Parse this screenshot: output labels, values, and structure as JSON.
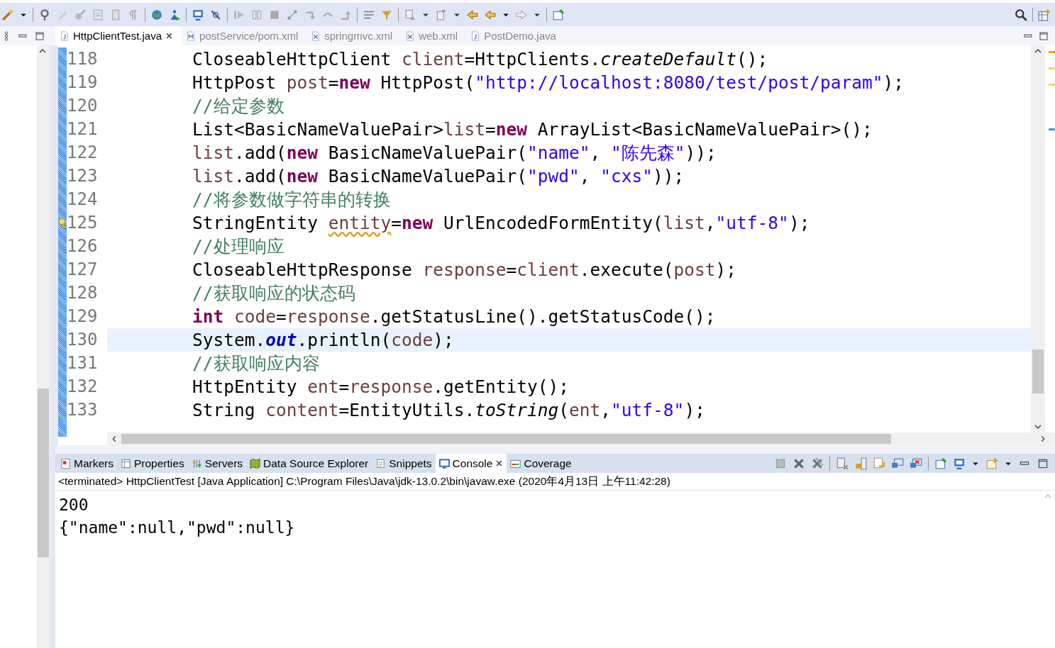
{
  "editor_tabs": [
    {
      "label": "HttpClientTest.java",
      "selected": true,
      "kind": "java"
    },
    {
      "label": "postService/pom.xml",
      "selected": false,
      "kind": "maven"
    },
    {
      "label": "springmvc.xml",
      "selected": false,
      "kind": "xml"
    },
    {
      "label": "web.xml",
      "selected": false,
      "kind": "xml"
    },
    {
      "label": "PostDemo.java",
      "selected": false,
      "kind": "java"
    }
  ],
  "code_lines": [
    {
      "number": "118",
      "current": false,
      "warning": false,
      "tokens": [
        {
          "kind": "plain",
          "text": "CloseableHttpClient "
        },
        {
          "kind": "variable",
          "text": "client"
        },
        {
          "kind": "plain",
          "text": "=HttpClients."
        },
        {
          "kind": "static_method",
          "text": "createDefault"
        },
        {
          "kind": "plain",
          "text": "();"
        }
      ]
    },
    {
      "number": "119",
      "current": false,
      "warning": false,
      "tokens": [
        {
          "kind": "plain",
          "text": "HttpPost "
        },
        {
          "kind": "variable",
          "text": "post"
        },
        {
          "kind": "plain",
          "text": "="
        },
        {
          "kind": "keyword",
          "text": "new"
        },
        {
          "kind": "plain",
          "text": " HttpPost("
        },
        {
          "kind": "string",
          "text": "\"http://localhost:8080/test/post/param\""
        },
        {
          "kind": "plain",
          "text": ");"
        }
      ]
    },
    {
      "number": "120",
      "current": false,
      "warning": false,
      "tokens": [
        {
          "kind": "comment",
          "text": "//给定参数"
        }
      ]
    },
    {
      "number": "121",
      "current": false,
      "warning": false,
      "tokens": [
        {
          "kind": "plain",
          "text": "List<BasicNameValuePair>"
        },
        {
          "kind": "variable",
          "text": "list"
        },
        {
          "kind": "plain",
          "text": "="
        },
        {
          "kind": "keyword",
          "text": "new"
        },
        {
          "kind": "plain",
          "text": " ArrayList<BasicNameValuePair>();"
        }
      ]
    },
    {
      "number": "122",
      "current": false,
      "warning": false,
      "tokens": [
        {
          "kind": "variable",
          "text": "list"
        },
        {
          "kind": "plain",
          "text": ".add("
        },
        {
          "kind": "keyword",
          "text": "new"
        },
        {
          "kind": "plain",
          "text": " BasicNameValuePair("
        },
        {
          "kind": "string",
          "text": "\"name\""
        },
        {
          "kind": "plain",
          "text": ", "
        },
        {
          "kind": "string",
          "text": "\"陈先森\""
        },
        {
          "kind": "plain",
          "text": "));"
        }
      ]
    },
    {
      "number": "123",
      "current": false,
      "warning": false,
      "tokens": [
        {
          "kind": "variable",
          "text": "list"
        },
        {
          "kind": "plain",
          "text": ".add("
        },
        {
          "kind": "keyword",
          "text": "new"
        },
        {
          "kind": "plain",
          "text": " BasicNameValuePair("
        },
        {
          "kind": "string",
          "text": "\"pwd\""
        },
        {
          "kind": "plain",
          "text": ", "
        },
        {
          "kind": "string",
          "text": "\"cxs\""
        },
        {
          "kind": "plain",
          "text": "));"
        }
      ]
    },
    {
      "number": "124",
      "current": false,
      "warning": false,
      "tokens": [
        {
          "kind": "comment",
          "text": "//将参数做字符串的转换"
        }
      ]
    },
    {
      "number": "125",
      "current": false,
      "warning": true,
      "tokens": [
        {
          "kind": "plain",
          "text": "StringEntity "
        },
        {
          "kind": "warned_variable",
          "text": "entity"
        },
        {
          "kind": "plain",
          "text": "="
        },
        {
          "kind": "keyword",
          "text": "new"
        },
        {
          "kind": "plain",
          "text": " UrlEncodedFormEntity("
        },
        {
          "kind": "variable",
          "text": "list"
        },
        {
          "kind": "plain",
          "text": ","
        },
        {
          "kind": "string",
          "text": "\"utf-8\""
        },
        {
          "kind": "plain",
          "text": ");"
        }
      ]
    },
    {
      "number": "126",
      "current": false,
      "warning": false,
      "tokens": [
        {
          "kind": "comment",
          "text": "//处理响应"
        }
      ]
    },
    {
      "number": "127",
      "current": false,
      "warning": false,
      "tokens": [
        {
          "kind": "plain",
          "text": "CloseableHttpResponse "
        },
        {
          "kind": "variable",
          "text": "response"
        },
        {
          "kind": "plain",
          "text": "="
        },
        {
          "kind": "variable",
          "text": "client"
        },
        {
          "kind": "plain",
          "text": ".execute("
        },
        {
          "kind": "variable",
          "text": "post"
        },
        {
          "kind": "plain",
          "text": ");"
        }
      ]
    },
    {
      "number": "128",
      "current": false,
      "warning": false,
      "tokens": [
        {
          "kind": "comment",
          "text": "//获取响应的状态码"
        }
      ]
    },
    {
      "number": "129",
      "current": false,
      "warning": false,
      "tokens": [
        {
          "kind": "keyword",
          "text": "int"
        },
        {
          "kind": "variable",
          "text": " code"
        },
        {
          "kind": "plain",
          "text": "="
        },
        {
          "kind": "variable",
          "text": "response"
        },
        {
          "kind": "plain",
          "text": ".getStatusLine().getStatusCode();"
        }
      ]
    },
    {
      "number": "130",
      "current": true,
      "warning": false,
      "tokens": [
        {
          "kind": "plain",
          "text": "System."
        },
        {
          "kind": "static_field",
          "text": "out"
        },
        {
          "kind": "plain",
          "text": ".println("
        },
        {
          "kind": "variable",
          "text": "code"
        },
        {
          "kind": "plain",
          "text": ");"
        }
      ]
    },
    {
      "number": "131",
      "current": false,
      "warning": false,
      "tokens": [
        {
          "kind": "comment",
          "text": "//获取响应内容"
        }
      ]
    },
    {
      "number": "132",
      "current": false,
      "warning": false,
      "tokens": [
        {
          "kind": "plain",
          "text": "HttpEntity "
        },
        {
          "kind": "variable",
          "text": "ent"
        },
        {
          "kind": "plain",
          "text": "="
        },
        {
          "kind": "variable",
          "text": "response"
        },
        {
          "kind": "plain",
          "text": ".getEntity();"
        }
      ]
    },
    {
      "number": "133",
      "current": false,
      "warning": false,
      "tokens": [
        {
          "kind": "plain",
          "text": "String "
        },
        {
          "kind": "variable",
          "text": "content"
        },
        {
          "kind": "plain",
          "text": "=EntityUtils."
        },
        {
          "kind": "static_method",
          "text": "toString"
        },
        {
          "kind": "plain",
          "text": "("
        },
        {
          "kind": "variable",
          "text": "ent"
        },
        {
          "kind": "plain",
          "text": ","
        },
        {
          "kind": "string",
          "text": "\"utf-8\""
        },
        {
          "kind": "plain",
          "text": ");"
        }
      ]
    }
  ],
  "view_tabs": [
    {
      "label": "Markers",
      "selected": false,
      "kind": "markers"
    },
    {
      "label": "Properties",
      "selected": false,
      "kind": "properties"
    },
    {
      "label": "Servers",
      "selected": false,
      "kind": "servers"
    },
    {
      "label": "Data Source Explorer",
      "selected": false,
      "kind": "datasource"
    },
    {
      "label": "Snippets",
      "selected": false,
      "kind": "snippets"
    },
    {
      "label": "Console",
      "selected": true,
      "kind": "console"
    },
    {
      "label": "Coverage",
      "selected": false,
      "kind": "coverage"
    }
  ],
  "console": {
    "header": "<terminated> HttpClientTest [Java Application] C:\\Program Files\\Java\\jdk-13.0.2\\bin\\javaw.exe (2020年4月13日 上午11:42:28)",
    "output": [
      "200",
      "{\"name\":null,\"pwd\":null}"
    ]
  }
}
